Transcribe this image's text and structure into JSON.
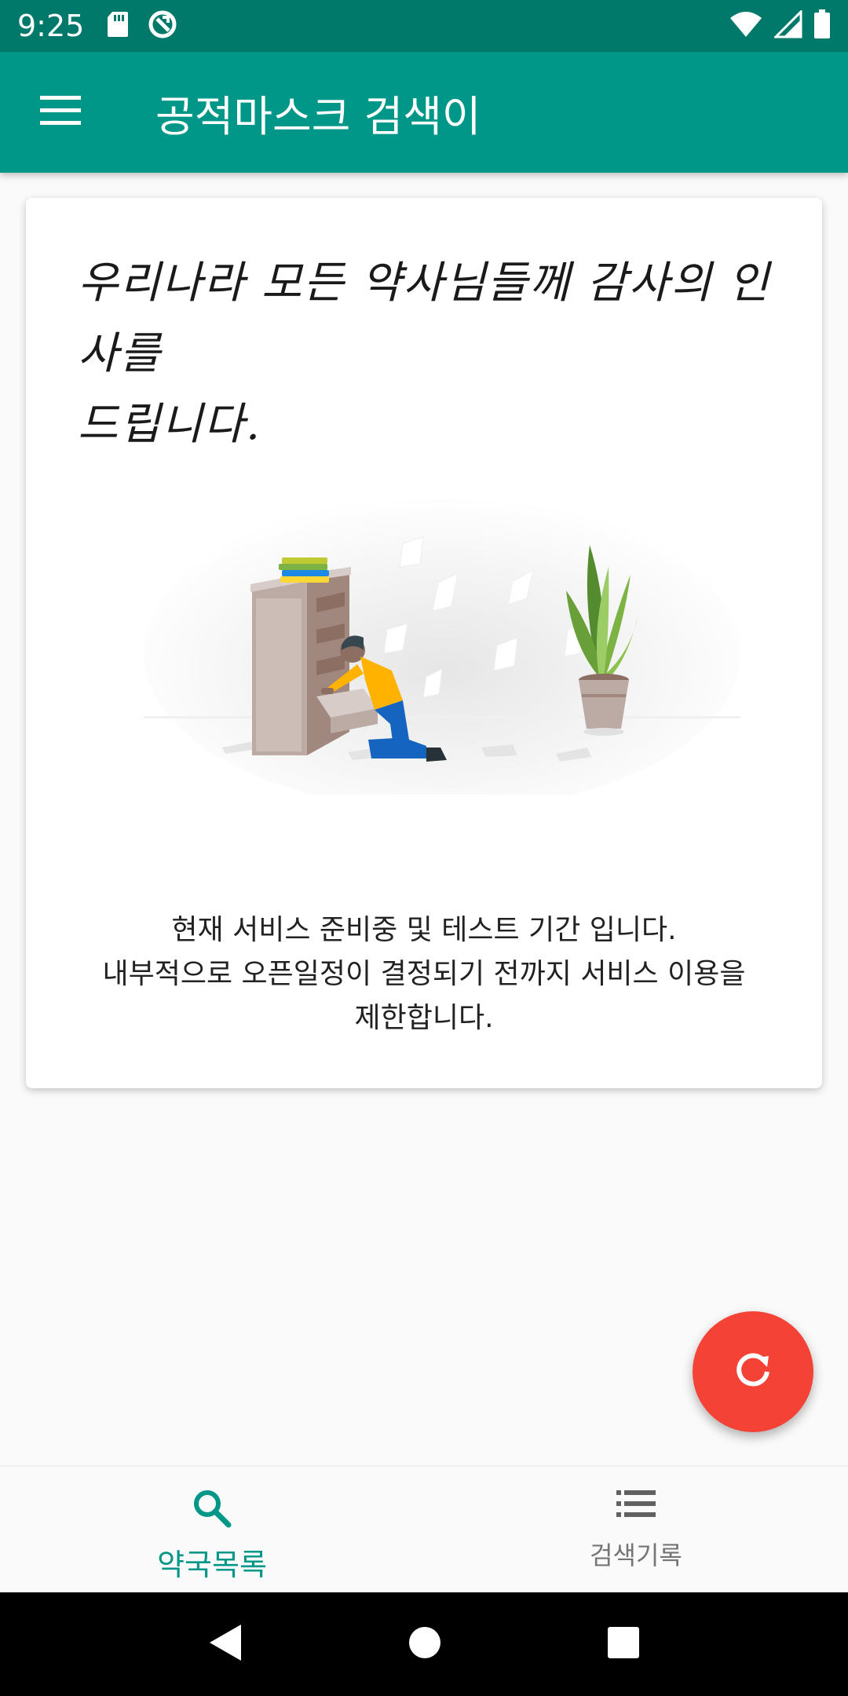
{
  "status_bar": {
    "time": "9:25",
    "left_icons": [
      "sd-card-icon",
      "sync-icon"
    ],
    "right_icons": [
      "wifi-icon",
      "signal-icon",
      "battery-icon"
    ]
  },
  "app_bar": {
    "menu_icon": "hamburger-menu-icon",
    "title": "공적마스크 검색이"
  },
  "card": {
    "thanks_line1": "우리나라 모든 약사님들께 감사의 인사를",
    "thanks_line2": "드립니다.",
    "illustration": "person-searching-drawer-illustration",
    "notice_line1": "현재 서비스 준비중 및 테스트 기간 입니다.",
    "notice_line2": "내부적으로 오픈일정이 결정되기 전까지 서비스 이용을",
    "notice_line3": "제한합니다."
  },
  "fab": {
    "icon": "refresh-icon",
    "color": "#f44336"
  },
  "bottom_nav": {
    "items": [
      {
        "label": "약국목록",
        "icon": "search-icon",
        "active": true
      },
      {
        "label": "검색기록",
        "icon": "list-icon",
        "active": false
      }
    ]
  },
  "system_nav": {
    "buttons": [
      "back-icon",
      "home-icon",
      "recents-icon"
    ]
  },
  "colors": {
    "primary": "#009688",
    "primary_dark": "#00796b",
    "accent": "#f44336"
  }
}
